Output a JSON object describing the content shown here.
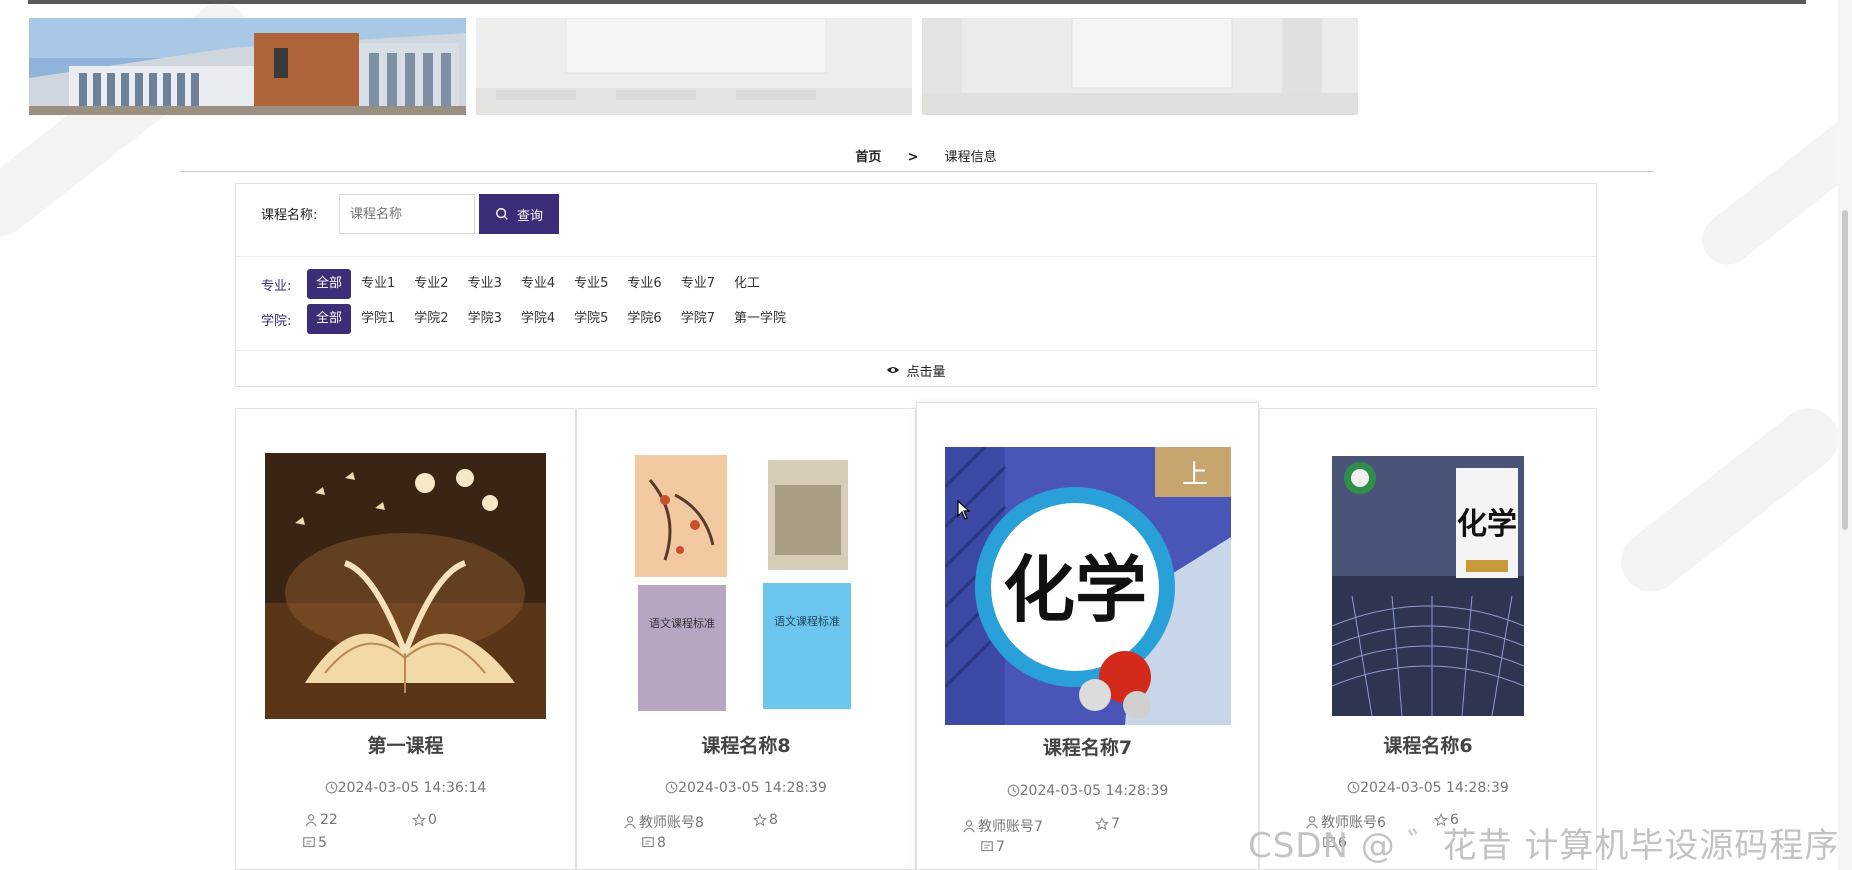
{
  "breadcrumb": {
    "home": "首页",
    "separator": ">",
    "current": "课程信息"
  },
  "search": {
    "label": "课程名称:",
    "placeholder": "课程名称",
    "button": "查询"
  },
  "filters": {
    "major": {
      "label": "专业:",
      "options": [
        "全部",
        "专业1",
        "专业2",
        "专业3",
        "专业4",
        "专业5",
        "专业6",
        "专业7",
        "化工"
      ],
      "selected": "全部"
    },
    "college": {
      "label": "学院:",
      "options": [
        "全部",
        "学院1",
        "学院2",
        "学院3",
        "学院4",
        "学院5",
        "学院6",
        "学院7",
        "第一学院"
      ],
      "selected": "全部"
    }
  },
  "sort": {
    "label": "点击量"
  },
  "courses": [
    {
      "title": "第一课程",
      "time": "2024-03-05 14:36:14",
      "teacher": "22",
      "favorites": "0",
      "comments": "5"
    },
    {
      "title": "课程名称8",
      "time": "2024-03-05 14:28:39",
      "teacher": "教师账号8",
      "favorites": "8",
      "comments": "8"
    },
    {
      "title": "课程名称7",
      "time": "2024-03-05 14:28:39",
      "teacher": "教师账号7",
      "favorites": "7",
      "comments": "7"
    },
    {
      "title": "课程名称6",
      "time": "2024-03-05 14:28:39",
      "teacher": "教师账号6",
      "favorites": "6",
      "comments": "6"
    }
  ],
  "cover_texts": {
    "chem_big": "化学",
    "chem_small": "化学",
    "chinese_1": "语文课程标准",
    "chinese_2": "语文课程标准",
    "upper": "上"
  },
  "watermark": "CSDN @ ゛花昔 计算机毕设源码程序",
  "colors": {
    "accent": "#3b2d78",
    "border": "#e3e3e3"
  }
}
